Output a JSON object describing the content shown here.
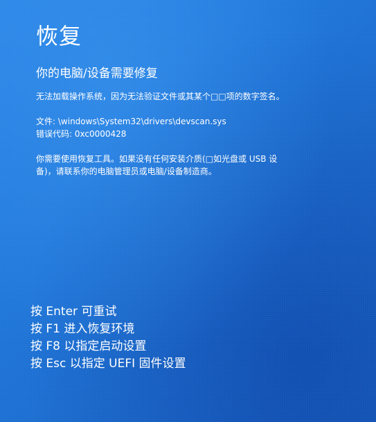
{
  "screen": {
    "title": "恢复",
    "subtitle": "你的电脑/设备需要修复",
    "reason": "无法加载操作系统，因为无法验证文件或其某个□□项的数字签名。",
    "file_label": "文件:",
    "file_path": "\\windows\\System32\\drivers\\devscan.sys",
    "error_label": "错误代码:",
    "error_code": "0xc0000428",
    "help_text": "你需要使用恢复工具。如果没有任何安装介质(□如光盘或 USB 设备)，请联系你的电脑管理员或电脑/设备制造商。"
  },
  "keys": [
    {
      "prefix": "按",
      "key": "Enter",
      "action": "可重试"
    },
    {
      "prefix": "按",
      "key": "F1",
      "action": "进入恢复环境"
    },
    {
      "prefix": "按",
      "key": "F8",
      "action": "以指定启动设置"
    },
    {
      "prefix": "按",
      "key": "Esc",
      "action": "以指定 UEFI 固件设置"
    }
  ],
  "colors": {
    "background": "#1e72d2",
    "text": "#ffffff"
  }
}
